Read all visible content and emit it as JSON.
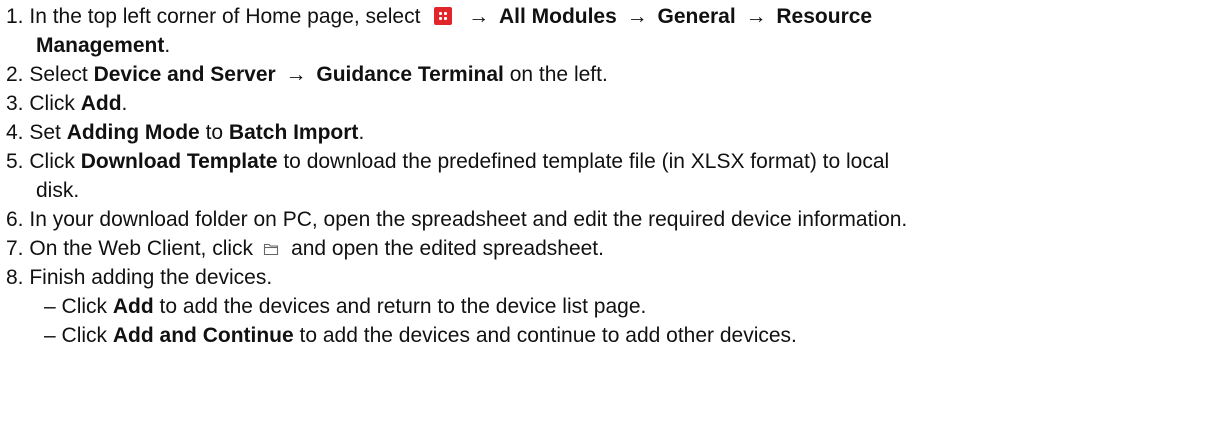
{
  "steps": [
    {
      "num": "1.",
      "pre": "In the top left corner of Home page, select",
      "icon": "red-grid-menu-icon",
      "arrow": "→",
      "path1": "All Modules",
      "path2": "General",
      "path3": "Resource",
      "path3_cont": "Management",
      "end": "."
    },
    {
      "num": "2.",
      "pre": "Select",
      "b1": "Device and Server",
      "arrow": "→",
      "b2": "Guidance Terminal",
      "post": "on the left."
    },
    {
      "num": "3.",
      "pre": "Click",
      "b1": "Add",
      "end": "."
    },
    {
      "num": "4.",
      "pre": "Set",
      "b1": "Adding Mode",
      "mid": "to",
      "b2": "Batch Import",
      "end": "."
    },
    {
      "num": "5.",
      "pre": "Click",
      "b1": "Download Template",
      "post": "to download the predefined template file (in XLSX format) to local",
      "cont": "disk."
    },
    {
      "num": "6.",
      "text": "In your download folder on PC, open the spreadsheet and edit the required device information."
    },
    {
      "num": "7.",
      "pre": "On the Web Client, click",
      "icon": "folder-icon",
      "post": "and open the edited spreadsheet."
    },
    {
      "num": "8.",
      "text": "Finish adding the devices."
    }
  ],
  "subs": [
    {
      "dash": "–",
      "pre": "Click",
      "b": "Add",
      "post": "to add the devices and return to the device list page."
    },
    {
      "dash": "–",
      "pre": "Click",
      "b": "Add and Continue",
      "post": "to add the devices and continue to add other devices."
    }
  ],
  "colors": {
    "menu_icon": "#e0262b",
    "text": "#111111",
    "folder_icon": "#666666"
  }
}
